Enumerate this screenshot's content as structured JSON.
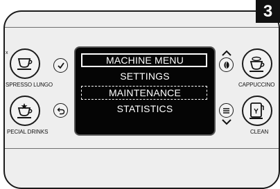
{
  "step": "3",
  "left_buttons": [
    {
      "label": "SPRESSO LUNGO",
      "icon": "espresso-cup-icon"
    },
    {
      "label": "PECIAL DRINKS",
      "icon": "special-drinks-cup-icon"
    }
  ],
  "right_buttons": [
    {
      "label": "CAPPUCCINO",
      "icon": "cappuccino-cup-icon"
    },
    {
      "label": "CLEAN",
      "icon": "clean-icon"
    }
  ],
  "left_edge_mark": "x",
  "display": {
    "title": "MACHINE MENU",
    "items": [
      "SETTINGS",
      "MAINTENANCE",
      "STATISTICS"
    ],
    "selected_index": 1
  },
  "colors": {
    "panel": "#eeeeee",
    "display": "#050505",
    "text": "#ffffff",
    "badge": "#111111"
  }
}
